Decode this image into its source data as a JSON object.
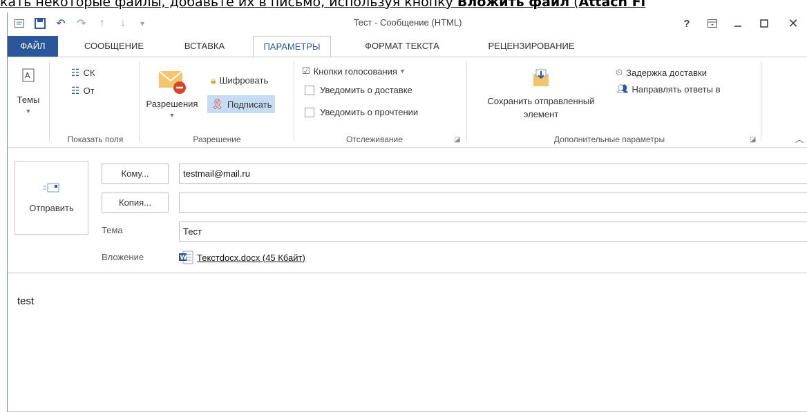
{
  "caption": {
    "prefix": "кать некоторые файлы, добавьте их в письмо, используя кнопку ",
    "bold1": "Вложить файл",
    "middle": " (",
    "bold2": "Attach Fi"
  },
  "window": {
    "title": "Тест - Сообщение (HTML)",
    "help": "?"
  },
  "tabs": [
    "ФАЙЛ",
    "СООБЩЕНИЕ",
    "ВСТАВКА",
    "ПАРАМЕТРЫ",
    "ФОРМАТ ТЕКСТА",
    "РЕЦЕНЗИРОВАНИЕ"
  ],
  "ribbon": {
    "themes": "Темы",
    "show_fields": {
      "cc": "СК",
      "from": "От",
      "group": "Показать поля"
    },
    "permission": {
      "main": "Разрешения",
      "encrypt": "Шифровать",
      "sign": "Подписать",
      "group": "Разрешение"
    },
    "tracking": {
      "vote": "Кнопки голосования",
      "delivery": "Уведомить о доставке",
      "read": "Уведомить о прочтении",
      "group": "Отслеживание"
    },
    "more": {
      "save_line1": "Сохранить отправленный",
      "save_line2": "элемент",
      "delay": "Задержка доставки",
      "direct": "Направлять ответы в",
      "group": "Дополнительные параметры"
    }
  },
  "compose": {
    "send": "Отправить",
    "to_btn": "Кому...",
    "to_value": "testmail@mail.ru",
    "cc_btn": "Копия...",
    "cc_value": "",
    "subject_label": "Тема",
    "subject_value": "Тест",
    "attach_label": "Вложение",
    "attach_file": "Текстdocx.docx (45 Кбайт)",
    "body_text": "test"
  },
  "colors": {
    "accent": "#2b579a",
    "highlight": "#c5dcf2",
    "envelope": "#f5c46e",
    "no": "#d9452b"
  }
}
